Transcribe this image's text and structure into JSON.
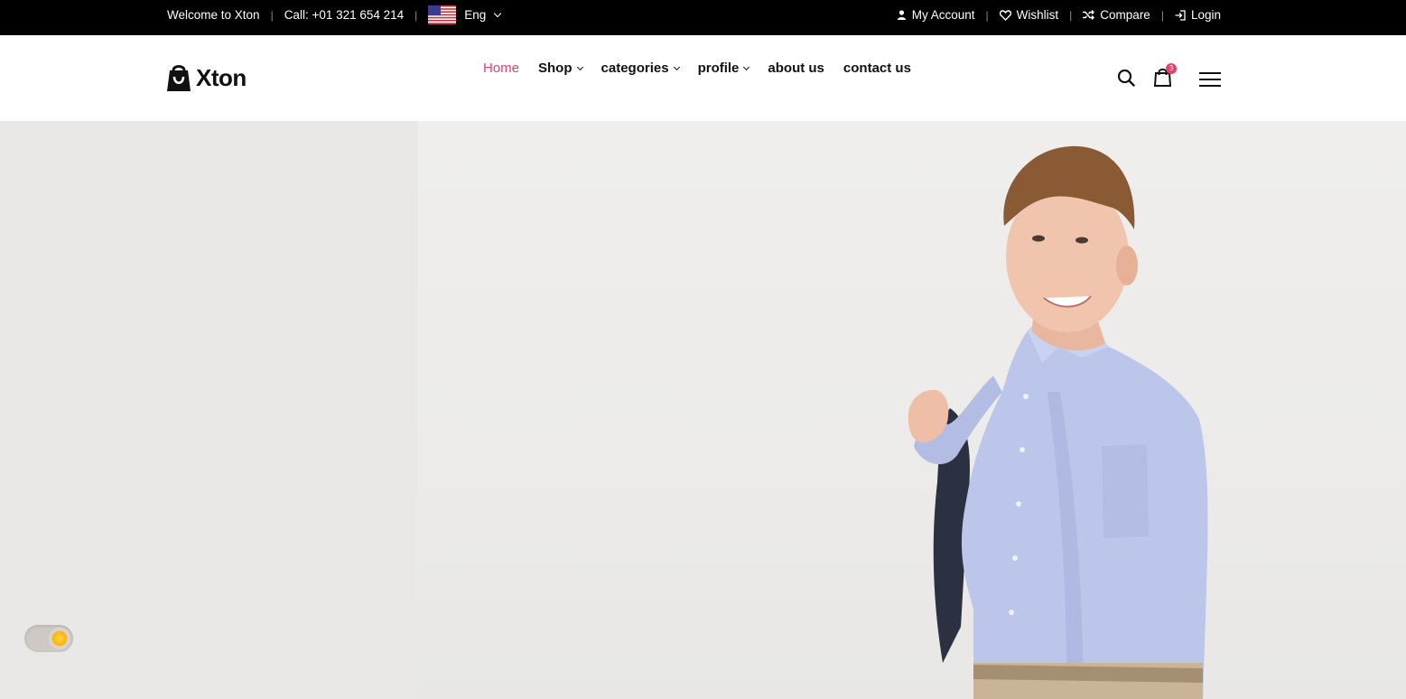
{
  "topbar": {
    "welcome": "Welcome to Xton",
    "call": "Call: +01 321 654 214",
    "language": "Eng",
    "my_account": "My Account",
    "wishlist": "Wishlist",
    "compare": "Compare",
    "login": "Login"
  },
  "header": {
    "brand": "Xton",
    "nav": {
      "home": "Home",
      "shop": "Shop",
      "categories": "categories",
      "profile": "profile",
      "about": "about us",
      "contact": "contact us"
    },
    "cart_count": "3"
  },
  "colors": {
    "accent": "#e63e6d",
    "topbar_bg": "#000000",
    "hero_bg": "#e9e8e6"
  },
  "icons": [
    "user-icon",
    "heart-icon",
    "shuffle-icon",
    "login-icon",
    "bag-logo-icon",
    "search-icon",
    "cart-icon",
    "menu-icon",
    "flag-us-icon"
  ],
  "theme_toggle": {
    "state": "light"
  }
}
